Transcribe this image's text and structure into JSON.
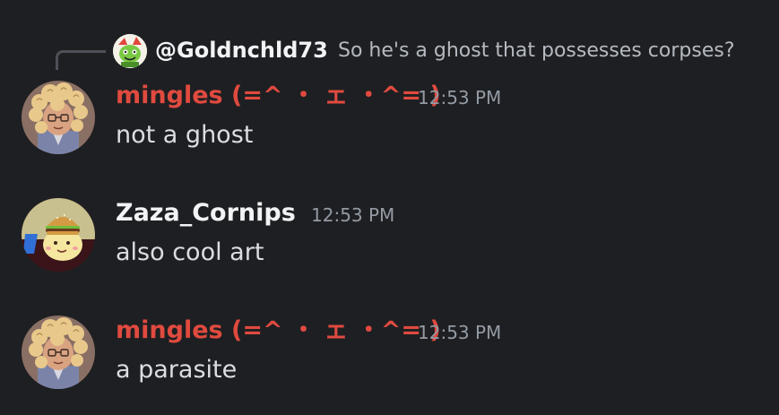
{
  "reply": {
    "author": "@Goldnchld73",
    "text": "So he's a ghost that possesses corpses?",
    "avatar_icon": "green-character-avatar-icon"
  },
  "messages": [
    {
      "author": "mingles (=^ ・ ェ ・^= )",
      "author_color": "#e04a3f",
      "timestamp": "12:53 PM",
      "content": "not a ghost",
      "avatar_icon": "curly-hair-character-avatar-icon"
    },
    {
      "author": "Zaza_Cornips",
      "author_color": "#f2f3f5",
      "timestamp": "12:53 PM",
      "content": "also cool art",
      "avatar_icon": "burger-hat-character-avatar-icon"
    },
    {
      "author": "mingles (=^ ・ ェ ・^= )",
      "author_color": "#e04a3f",
      "timestamp": "12:53 PM",
      "content": "a parasite",
      "avatar_icon": "curly-hair-character-avatar-icon"
    }
  ]
}
